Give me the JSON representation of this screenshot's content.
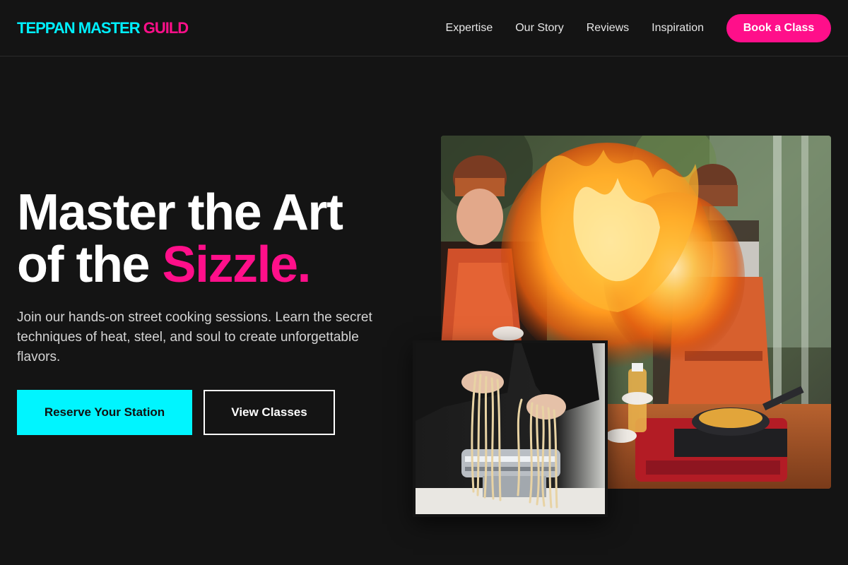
{
  "brand": {
    "part1": "TEPPAN MASTER",
    "part2": "GUILD",
    "color1": "#00f0ff",
    "color2": "#ff0f8a"
  },
  "nav": {
    "items": [
      "Expertise",
      "Our Story",
      "Reviews",
      "Inspiration"
    ],
    "cta_label": "Book a Class"
  },
  "hero": {
    "title_line1": "Master the Art",
    "title_line2_prefix": "of the ",
    "title_accent": "Sizzle.",
    "description": "Join our hands-on street cooking sessions. Learn the secret techniques of heat, steel, and soul to create unforgettable flavors.",
    "primary_button": "Reserve Your Station",
    "secondary_button": "View Classes"
  },
  "images": {
    "main_icon": "photo-flambe-cooking-class",
    "secondary_icon": "photo-fresh-pasta-noodles"
  },
  "colors": {
    "background": "#141414",
    "accent_pink": "#ff0f8a",
    "accent_cyan": "#00f5ff"
  }
}
